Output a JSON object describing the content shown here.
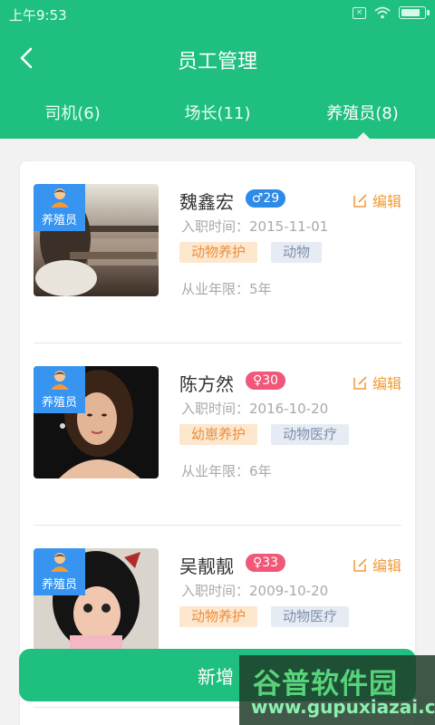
{
  "status_bar": {
    "time": "上午9:53"
  },
  "header": {
    "title": "员工管理"
  },
  "tabs": [
    {
      "label": "司机(6)",
      "active": false
    },
    {
      "label": "场长(11)",
      "active": false
    },
    {
      "label": "养殖员(8)",
      "active": true
    }
  ],
  "employees": [
    {
      "name": "魏鑫宏",
      "gender": "male",
      "age": "29",
      "age_badge": "♂29",
      "role": "养殖员",
      "joined_date": "入职时间：2015-11-01",
      "tags": [
        "动物养护",
        "动物"
      ],
      "years": "从业年限：5年",
      "edit_label": "编辑"
    },
    {
      "name": "陈方然",
      "gender": "female",
      "age": "30",
      "age_badge": "♀30",
      "role": "养殖员",
      "joined_date": "入职时间：2016-10-20",
      "tags": [
        "幼崽养护",
        "动物医疗"
      ],
      "years": "从业年限：6年",
      "edit_label": "编辑"
    },
    {
      "name": "吴靓靓",
      "gender": "female",
      "age": "33",
      "age_badge": "♀33",
      "role": "养殖员",
      "joined_date": "入职时间：2009-10-20",
      "tags": [
        "动物养护",
        "动物医疗"
      ],
      "years": "",
      "edit_label": "编辑"
    }
  ],
  "add_button": {
    "label": "新增"
  },
  "watermark": {
    "title": "谷普软件园",
    "url": "www.gupuxiazai.com"
  },
  "colors": {
    "primary": "#1fbf80",
    "edit": "#f29a35",
    "male": "#2c8be8",
    "female": "#f05778"
  }
}
